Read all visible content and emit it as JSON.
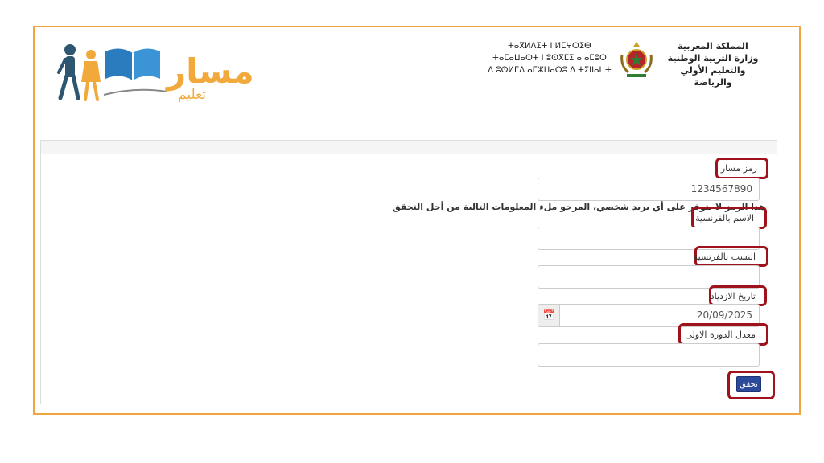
{
  "logo": {
    "word": "مسار",
    "subtitle": "تعليم"
  },
  "header": {
    "tifinagh_lines": [
      "ⵜⴰⴳⵍⴷⵉⵜ ⵏ ⵍⵎⵖⵔⵉⴱ",
      "ⵜⴰⵎⴰⵡⴰⵙⵜ ⵏ ⵓⵙⴳⵎⵉ ⴰⵏⴰⵎⵓⵔ",
      "ⴷ ⵓⵙⵍⵎⴷ ⴰⵎⵣⵡⴰⵔⵓ ⴷ ⵜⵉⵏⵏⴰⵡⵜ"
    ],
    "arabic_lines": [
      "المملكة المغربية",
      "وزارة التربية الوطنية",
      "والتعليم الأولي والرياضة"
    ]
  },
  "form": {
    "code_label": "رمز مسار",
    "code_value": "1234567890",
    "notice": "هذا الرمز لا يتوفر على أي بريد شخصي، المرجو ملء المعلومات التالية من أجل التحقق",
    "firstname_label": "الاسم بالفرنسية",
    "firstname_value": "",
    "lastname_label": "النسب بالفرنسية",
    "lastname_value": "",
    "birthdate_label": "تاريخ الازدياد",
    "birthdate_value": "20/09/2025",
    "average_label": "معدل الدورة الاولى",
    "average_value": "",
    "submit_label": "تحقق",
    "calendar_icon": "calendar-icon"
  },
  "colors": {
    "frame": "#f0a640",
    "highlight": "#a0121b",
    "button": "#2b4a99",
    "logo": "#f2a93b"
  }
}
